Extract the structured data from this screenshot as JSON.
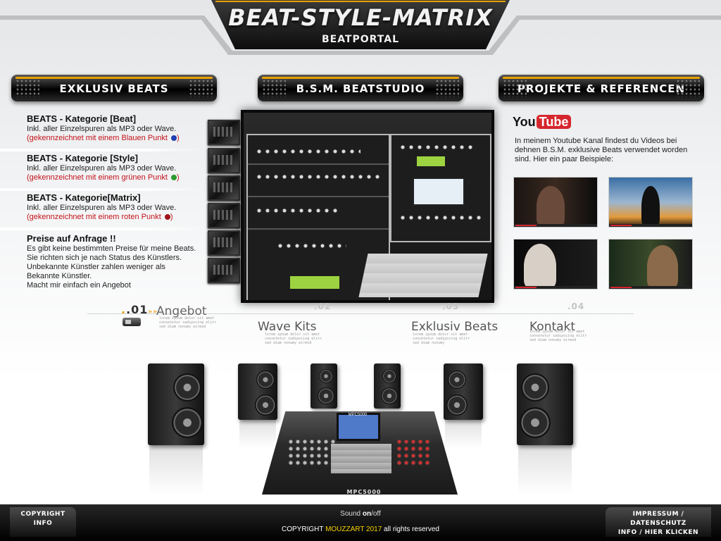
{
  "header": {
    "title": "BEAT-STYLE-MATRIX",
    "subtitle": "BEATPORTAL"
  },
  "sections": {
    "left": "EXKLUSIV BEATS",
    "center": "B.S.M. BEATSTUDIO",
    "right": "PROJEKTE & REFERENCEN"
  },
  "categories": [
    {
      "title": "BEATS - Kategorie [Beat]",
      "desc": "Inkl. aller Einzelspuren als MP3 oder  Wave.",
      "note": "(gekennzeichnet mit einem Blauen Punkt",
      "close": ")",
      "dot_color": "#1f3fb0"
    },
    {
      "title": "BEATS - Kategorie [Style]",
      "desc": "Inkl. aller Einzelspuren als MP3 oder  Wave.",
      "note": "(gekennzeichnet mit einem grünen Punkt",
      "close": ")",
      "dot_color": "#2e9a2e"
    },
    {
      "title": "BEATS - Kategorie[Matrix]",
      "desc": "Inkl. aller Einzelspuren als MP3 oder  Wave.",
      "note": "(gekennzeichnet mit einem roten Punkt",
      "close": ")",
      "dot_color": "#a0151a"
    }
  ],
  "prices": {
    "title": "Preise auf Anfrage !!",
    "lines": [
      "Es gibt keine bestimmten Preise für meine Beats.",
      "Sie richten sich je nach Status des Künstlers.",
      "Unbekannte Künstler zahlen weniger als",
      "Bekannte Künstler.",
      "Macht mir einfach ein Angebot"
    ]
  },
  "youtube": {
    "logo_you": "You",
    "logo_tube": "Tube",
    "text": "In meinem Youtube Kanal findest du Videos bei dehnen B.S.M. exklusive Beats verwendet worden sind. Hier ein paar Beispiele:"
  },
  "nav": [
    {
      "num": ".01",
      "arrows": "»»",
      "label": "Angebot",
      "sub": "lorem ipsum dolor sit amet consetetur sadipscing elitr sed diam nonumy eirmod"
    },
    {
      "num": ".02",
      "label": "Wave Kits",
      "sub": "lorem ipsum dolor sit amet consetetur sadipscing elitr sed diam nonumy eirmod"
    },
    {
      "num": ".03",
      "label": "Exklusiv Beats",
      "sub": "lorem ipsum dolor sit amet consetetur sadipscing elitr sed diam nonumy"
    },
    {
      "num": ".04",
      "label": "Kontakt",
      "sub": "lorem ipsum dolor sit amet consetetur sadipscing elitr sed diam nonumy eirmod"
    }
  ],
  "mpc": {
    "top": "MPC5000",
    "label": "MPC5000"
  },
  "footer": {
    "left_line1": "COPYRIGHT",
    "left_line2": "INFO",
    "sound_prefix": "Sound ",
    "sound_on": "on",
    "sound_sep": "/",
    "sound_off": "off",
    "copyright_prefix": "COPYRIGHT ",
    "copyright_brand": "MOUZZART 2017",
    "copyright_suffix": " all rights reserved",
    "right_line1": "IMPRESSUM / DATENSCHUTZ",
    "right_line2": "INFO  /  HIER KLICKEN"
  },
  "colors": {
    "accent": "#e8a000",
    "red": "#c4121a",
    "youtube_red": "#d6262d"
  }
}
